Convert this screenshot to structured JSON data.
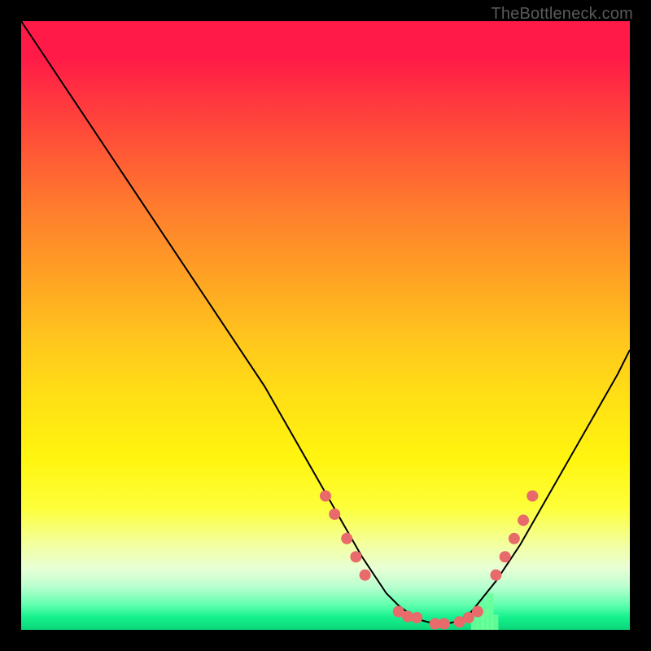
{
  "watermark": "TheBottleneck.com",
  "chart_data": {
    "type": "line",
    "title": "",
    "xlabel": "",
    "ylabel": "",
    "xlim": [
      0,
      100
    ],
    "ylim": [
      0,
      100
    ],
    "grid": false,
    "legend": false,
    "series": [
      {
        "name": "bottleneck-curve",
        "x": [
          0,
          4,
          8,
          12,
          16,
          20,
          24,
          28,
          32,
          36,
          40,
          44,
          48,
          52,
          56,
          58,
          60,
          62,
          64,
          66,
          68,
          70,
          72,
          74,
          78,
          82,
          86,
          90,
          94,
          98,
          100
        ],
        "y": [
          100,
          94,
          88,
          82,
          76,
          70,
          64,
          58,
          52,
          46,
          40,
          33,
          26,
          19,
          12,
          9,
          6,
          4,
          2.5,
          1.5,
          1,
          1,
          1.5,
          3,
          8,
          14,
          21,
          28,
          35,
          42,
          46
        ],
        "stroke": "#000000",
        "stroke_width": 2
      }
    ],
    "markers": [
      {
        "name": "highlight-dots",
        "color": "#e86a6a",
        "radius": 7,
        "points": [
          {
            "x": 50.0,
            "y": 22
          },
          {
            "x": 51.5,
            "y": 19
          },
          {
            "x": 53.5,
            "y": 15
          },
          {
            "x": 55.0,
            "y": 12
          },
          {
            "x": 56.5,
            "y": 9
          },
          {
            "x": 62.0,
            "y": 3
          },
          {
            "x": 63.5,
            "y": 2.2
          },
          {
            "x": 65.0,
            "y": 2
          },
          {
            "x": 68.0,
            "y": 1
          },
          {
            "x": 69.5,
            "y": 1
          },
          {
            "x": 72.0,
            "y": 1.3
          },
          {
            "x": 73.5,
            "y": 2
          },
          {
            "x": 75.0,
            "y": 3
          },
          {
            "x": 78.0,
            "y": 9
          },
          {
            "x": 79.5,
            "y": 12
          },
          {
            "x": 81.0,
            "y": 15
          },
          {
            "x": 82.5,
            "y": 18
          },
          {
            "x": 84.0,
            "y": 22
          }
        ]
      }
    ],
    "ticks_near_floor": {
      "name": "green-ticks",
      "color": "#6cff99",
      "half_width": 0.6,
      "points": [
        {
          "x": 74.5,
          "h": 3.0
        },
        {
          "x": 75.5,
          "h": 5.0
        },
        {
          "x": 76.2,
          "h": 3.5
        },
        {
          "x": 77.0,
          "h": 6.0
        },
        {
          "x": 77.8,
          "h": 2.5
        }
      ]
    },
    "background": {
      "type": "vertical-gradient",
      "stops": [
        {
          "pos": 0,
          "color": "#ff1a47"
        },
        {
          "pos": 100,
          "color": "#0cd67a"
        }
      ]
    }
  }
}
